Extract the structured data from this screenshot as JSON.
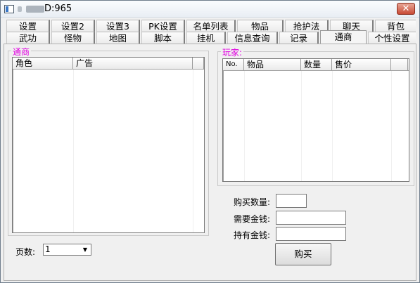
{
  "window": {
    "title": "D:965",
    "close_label": "✕"
  },
  "tabs_row1": [
    "设置",
    "设置2",
    "设置3",
    "PK设置",
    "名单列表",
    "物品",
    "抢护法",
    "聊天",
    "背包"
  ],
  "tabs_row2": [
    "武功",
    "怪物",
    "地图",
    "脚本",
    "挂机",
    "信息查询",
    "记录",
    "通商",
    "个性设置"
  ],
  "active_tab": "通商",
  "merchant_group": {
    "label": "通商",
    "columns": [
      "角色",
      "广告"
    ]
  },
  "player_group": {
    "label": "玩家:",
    "columns": [
      "No.",
      "物品",
      "数量",
      "售价"
    ]
  },
  "purchase": {
    "quantity_label": "购买数量:",
    "quantity_value": "",
    "required_money_label": "需要金钱:",
    "required_money_value": "",
    "held_money_label": "持有金钱:",
    "held_money_value": "",
    "buy_button": "购买"
  },
  "pager": {
    "label": "页数:",
    "selected": "1"
  },
  "colors": {
    "group_label": "#e000e0",
    "close_button": "#c94a35"
  }
}
